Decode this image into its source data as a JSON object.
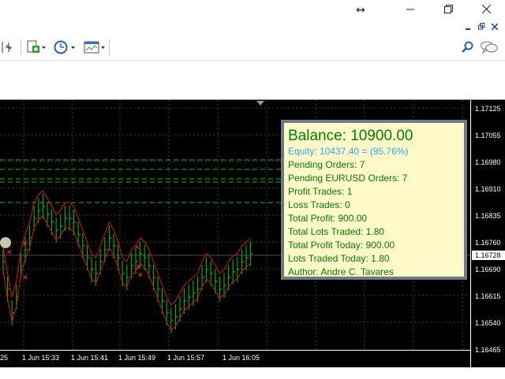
{
  "window": {
    "resize_icon": "horizontal-resize-icon",
    "minimize_icon": "minimize-icon",
    "restore_icon": "restore-icon",
    "close_icon": "close-icon"
  },
  "mdi_controls": [
    "minimize-icon",
    "restore-icon",
    "close-icon"
  ],
  "toolbar": {
    "tools": [
      "crosshair-icon",
      "new-order-icon",
      "clock-icon",
      "templates-icon"
    ]
  },
  "chart": {
    "symbol_hidden": true,
    "price_scale": [
      "1.17125",
      "1.17055",
      "1.16980",
      "1.16910",
      "1.16835",
      "1.16760",
      "1.16690",
      "1.16615",
      "1.16540",
      "1.16465"
    ],
    "current_price": "1.16728",
    "time_labels": [
      "25",
      "1 Jun 15:33",
      "1 Jun 15:41",
      "1 Jun 15:49",
      "1 Jun 15:57",
      "1 Jun 16:05"
    ]
  },
  "info_panel": {
    "balance": "Balance: 10900.00",
    "equity": "Equity: 10437.40 = (95.76%)",
    "lines": [
      "Pending Orders: 7",
      "Pending EURUSD Orders: 7",
      "Profit Trades: 1",
      "Loss Trades: 0",
      "Total Profit: 900.00",
      "Total Lots Traded: 1.80",
      "Total Profit Today: 900.00",
      "Lots Traded Today: 1.80",
      "Author: Andre C. Tavares"
    ]
  },
  "colors": {
    "candle": "#00c800",
    "bands": "#e01010",
    "levels": "#00c800",
    "panel_bg": "#fff8c8",
    "panel_border": "#6f7a82",
    "equity_text": "#2eaee0",
    "panel_text": "#008000"
  }
}
